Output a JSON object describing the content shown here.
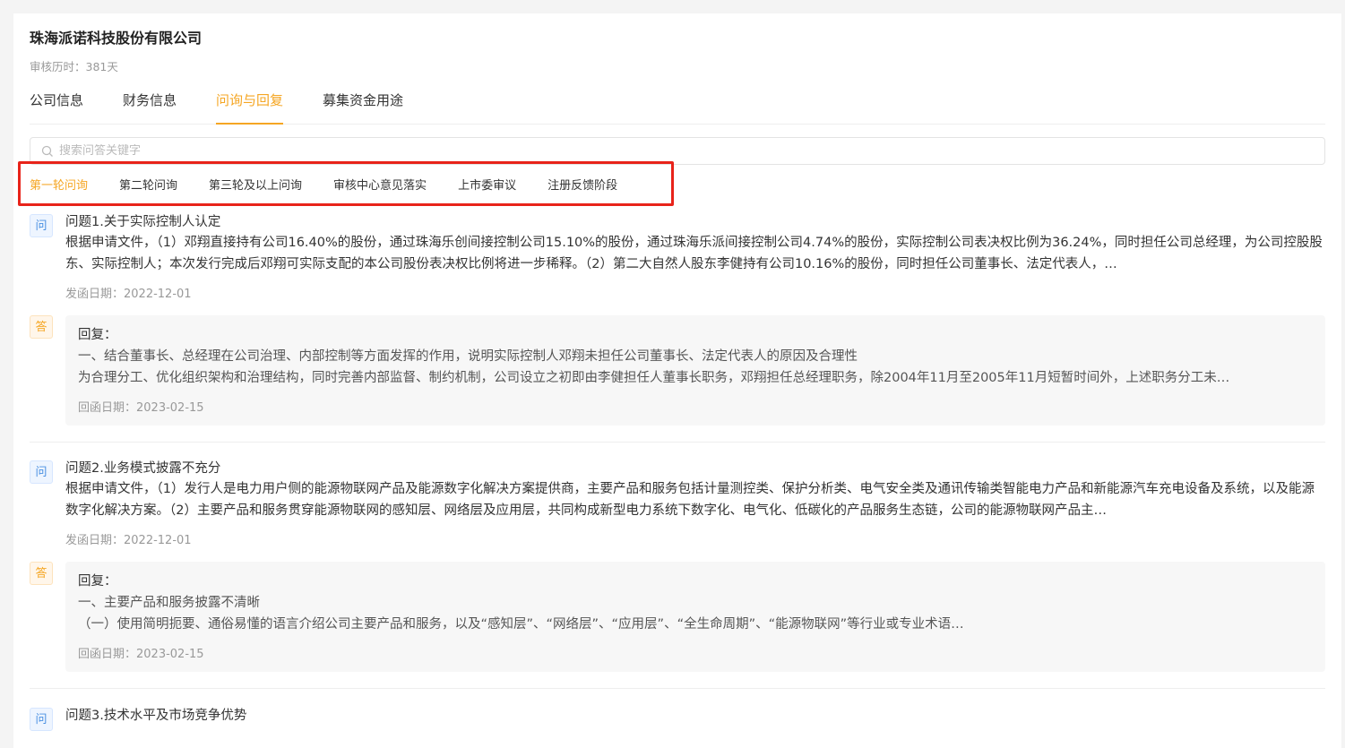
{
  "company": {
    "name": "珠海派诺科技股份有限公司",
    "review_duration": "审核历时：381天"
  },
  "tabs": [
    {
      "label": "公司信息"
    },
    {
      "label": "财务信息"
    },
    {
      "label": "问询与回复"
    },
    {
      "label": "募集资金用途"
    }
  ],
  "search": {
    "placeholder": "搜索问答关键字",
    "value": ""
  },
  "subtabs": [
    {
      "label": "第一轮问询"
    },
    {
      "label": "第二轮问询"
    },
    {
      "label": "第三轮及以上问询"
    },
    {
      "label": "审核中心意见落实"
    },
    {
      "label": "上市委审议"
    },
    {
      "label": "注册反馈阶段"
    }
  ],
  "badges": {
    "question": "问",
    "answer": "答",
    "reply_label": "回复："
  },
  "items": [
    {
      "title": "问题1.关于实际控制人认定",
      "text": "根据申请文件，（1）邓翔直接持有公司16.40%的股份，通过珠海乐创间接控制公司15.10%的股份，通过珠海乐派间接控制公司4.74%的股份，实际控制公司表决权比例为36.24%，同时担任公司总经理，为公司控股股东、实际控制人；本次发行完成后邓翔可实际支配的本公司股份表决权比例将进一步稀释。（2）第二大自然人股东李健持有公司10.16%的股份，同时担任公司董事长、法定代表人，…",
      "sent_date": "发函日期：2022-12-01",
      "reply_lines": [
        "一、结合董事长、总经理在公司治理、内部控制等方面发挥的作用，说明实际控制人邓翔未担任公司董事长、法定代表人的原因及合理性",
        "为合理分工、优化组织架构和治理结构，同时完善内部监督、制约机制，公司设立之初即由李健担任人董事长职务，邓翔担任总经理职务，除2004年11月至2005年11月短暂时间外，上述职务分工未…"
      ],
      "reply_date": "回函日期：2023-02-15"
    },
    {
      "title": "问题2.业务模式披露不充分",
      "text": "根据申请文件，（1）发行人是电力用户侧的能源物联网产品及能源数字化解决方案提供商，主要产品和服务包括计量测控类、保护分析类、电气安全类及通讯传输类智能电力产品和新能源汽车充电设备及系统，以及能源数字化解决方案。（2）主要产品和服务贯穿能源物联网的感知层、网络层及应用层，共同构成新型电力系统下数字化、电气化、低碳化的产品服务生态链，公司的能源物联网产品主…",
      "sent_date": "发函日期：2022-12-01",
      "reply_lines": [
        "一、主要产品和服务披露不清晰",
        "（一）使用简明扼要、通俗易懂的语言介绍公司主要产品和服务，以及“感知层”、“网络层”、“应用层”、“全生命周期”、“能源物联网”等行业或专业术语…"
      ],
      "reply_date": "回函日期：2023-02-15"
    },
    {
      "title": "问题3.技术水平及市场竞争优势"
    }
  ]
}
